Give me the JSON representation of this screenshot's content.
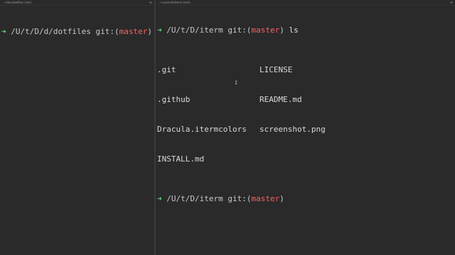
{
  "left_pane": {
    "title": "~/dev/dotfiles (zsh)",
    "close_control": "⌘",
    "prompt": {
      "arrow": "➜",
      "path": "/U/t/D/d/dotfiles",
      "git_prefix": "git:(",
      "branch": "master",
      "git_suffix": ")"
    }
  },
  "right_pane": {
    "title": "~cuments/iterm (zsh)",
    "close_control": "⌘",
    "prompt1": {
      "arrow": "➜",
      "path": "/U/t/D/iterm",
      "git_prefix": "git:(",
      "branch": "master",
      "git_suffix": ")",
      "command": "ls"
    },
    "ls_output": [
      [
        ".git",
        "LICENSE"
      ],
      [
        ".github",
        "README.md"
      ],
      [
        "Dracula.itermcolors",
        "screenshot.png"
      ],
      [
        "INSTALL.md",
        ""
      ]
    ],
    "prompt2": {
      "arrow": "➜",
      "path": "/U/t/D/iterm",
      "git_prefix": "git:(",
      "branch": "master",
      "git_suffix": ")"
    }
  },
  "mouse_cursor": "I",
  "colors": {
    "background": "#2a2a2a",
    "prompt_arrow": "#5fd787",
    "branch": "#ff5f5f",
    "text": "#d8d8d8"
  }
}
